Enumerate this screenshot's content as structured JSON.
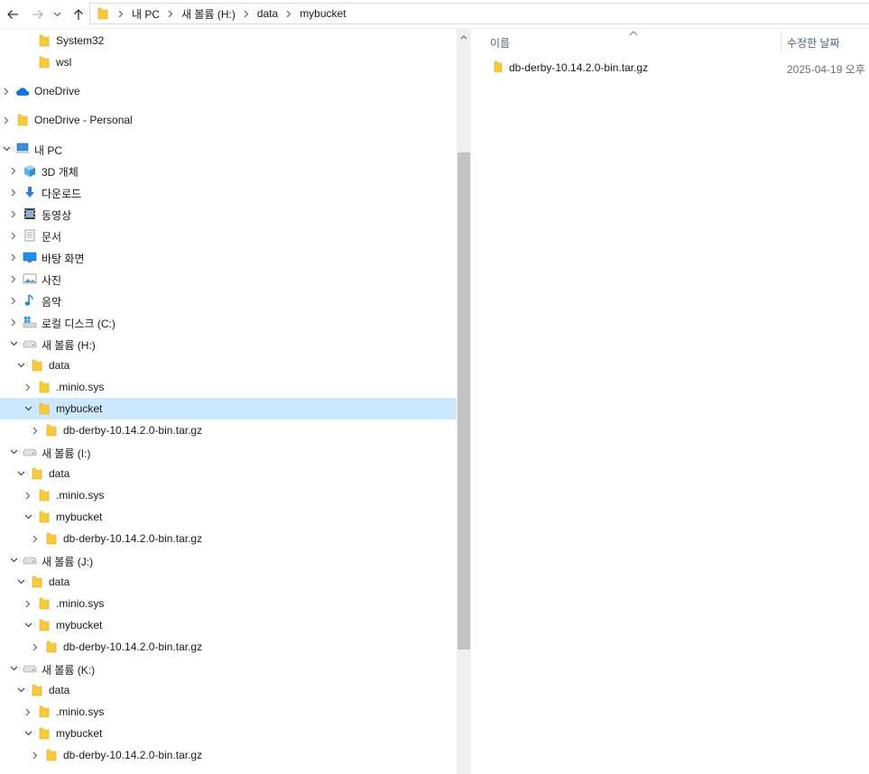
{
  "address": {
    "crumbs": [
      "내 PC",
      "새 볼륨 (H:)",
      "data",
      "mybucket"
    ]
  },
  "nav": {
    "items": [
      {
        "label": "System32",
        "icon": "folder-icon",
        "expander": "none"
      },
      {
        "label": "wsl",
        "icon": "folder-icon",
        "expander": "none"
      },
      {
        "label": "OneDrive",
        "icon": "onedrive-cloud-icon",
        "expander": "collapsed"
      },
      {
        "label": "OneDrive - Personal",
        "icon": "folder-icon",
        "expander": "collapsed"
      },
      {
        "label": "내 PC",
        "icon": "this-pc-icon",
        "expander": "expanded"
      },
      {
        "label": "3D 개체",
        "icon": "3d-objects-icon",
        "expander": "collapsed"
      },
      {
        "label": "다운로드",
        "icon": "downloads-icon",
        "expander": "collapsed"
      },
      {
        "label": "동영상",
        "icon": "videos-icon",
        "expander": "collapsed"
      },
      {
        "label": "문서",
        "icon": "documents-icon",
        "expander": "collapsed"
      },
      {
        "label": "바탕 화면",
        "icon": "desktop-icon",
        "expander": "collapsed"
      },
      {
        "label": "사진",
        "icon": "pictures-icon",
        "expander": "collapsed"
      },
      {
        "label": "음악",
        "icon": "music-icon",
        "expander": "collapsed"
      },
      {
        "label": "로컬 디스크 (C:)",
        "icon": "system-drive-icon",
        "expander": "collapsed"
      },
      {
        "label": "새 볼륨 (H:)",
        "icon": "drive-icon",
        "expander": "expanded"
      },
      {
        "label": "data",
        "icon": "folder-icon",
        "expander": "expanded"
      },
      {
        "label": ".minio.sys",
        "icon": "folder-icon",
        "expander": "collapsed"
      },
      {
        "label": "mybucket",
        "icon": "folder-icon",
        "expander": "expanded",
        "selected": true
      },
      {
        "label": "db-derby-10.14.2.0-bin.tar.gz",
        "icon": "folder-icon",
        "expander": "collapsed"
      },
      {
        "label": "새 볼륨 (I:)",
        "icon": "drive-icon",
        "expander": "expanded"
      },
      {
        "label": "data",
        "icon": "folder-icon",
        "expander": "expanded"
      },
      {
        "label": ".minio.sys",
        "icon": "folder-icon",
        "expander": "collapsed"
      },
      {
        "label": "mybucket",
        "icon": "folder-icon",
        "expander": "expanded"
      },
      {
        "label": "db-derby-10.14.2.0-bin.tar.gz",
        "icon": "folder-icon",
        "expander": "collapsed"
      },
      {
        "label": "새 볼륨 (J:)",
        "icon": "drive-icon",
        "expander": "expanded"
      },
      {
        "label": "data",
        "icon": "folder-icon",
        "expander": "expanded"
      },
      {
        "label": ".minio.sys",
        "icon": "folder-icon",
        "expander": "collapsed"
      },
      {
        "label": "mybucket",
        "icon": "folder-icon",
        "expander": "expanded"
      },
      {
        "label": "db-derby-10.14.2.0-bin.tar.gz",
        "icon": "folder-icon",
        "expander": "collapsed"
      },
      {
        "label": "새 볼륨 (K:)",
        "icon": "drive-icon",
        "expander": "expanded"
      },
      {
        "label": "data",
        "icon": "folder-icon",
        "expander": "expanded"
      },
      {
        "label": ".minio.sys",
        "icon": "folder-icon",
        "expander": "collapsed"
      },
      {
        "label": "mybucket",
        "icon": "folder-icon",
        "expander": "expanded"
      },
      {
        "label": "db-derby-10.14.2.0-bin.tar.gz",
        "icon": "folder-icon",
        "expander": "collapsed"
      }
    ]
  },
  "filelist": {
    "columns": {
      "name": "이름",
      "date": "수정한 날짜"
    },
    "files": [
      {
        "name": "db-derby-10.14.2.0-bin.tar.gz",
        "date": "2025-04-19 오후",
        "icon": "folder-icon"
      }
    ]
  },
  "colors": {
    "selection": "#cce8ff",
    "folder": "#f8c940",
    "header_text": "#4c607a"
  }
}
